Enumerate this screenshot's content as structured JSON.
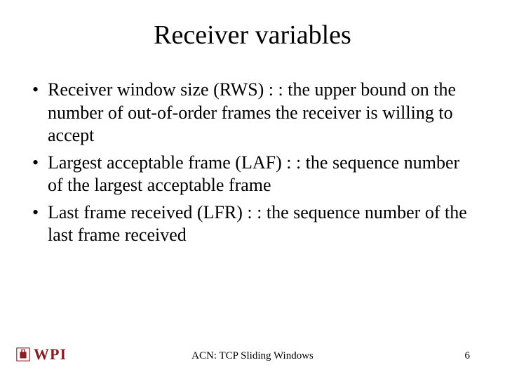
{
  "title": "Receiver variables",
  "bullets": [
    "Receiver window size (RWS) : : the upper bound on the number of out-of-order frames the receiver is willing to accept",
    "Largest acceptable frame (LAF) : : the sequence number of the largest acceptable frame",
    "Last frame received (LFR) : : the sequence number of the last frame received"
  ],
  "footer": {
    "logo_text": "WPI",
    "center": "ACN: TCP Sliding Windows",
    "page": "6"
  }
}
